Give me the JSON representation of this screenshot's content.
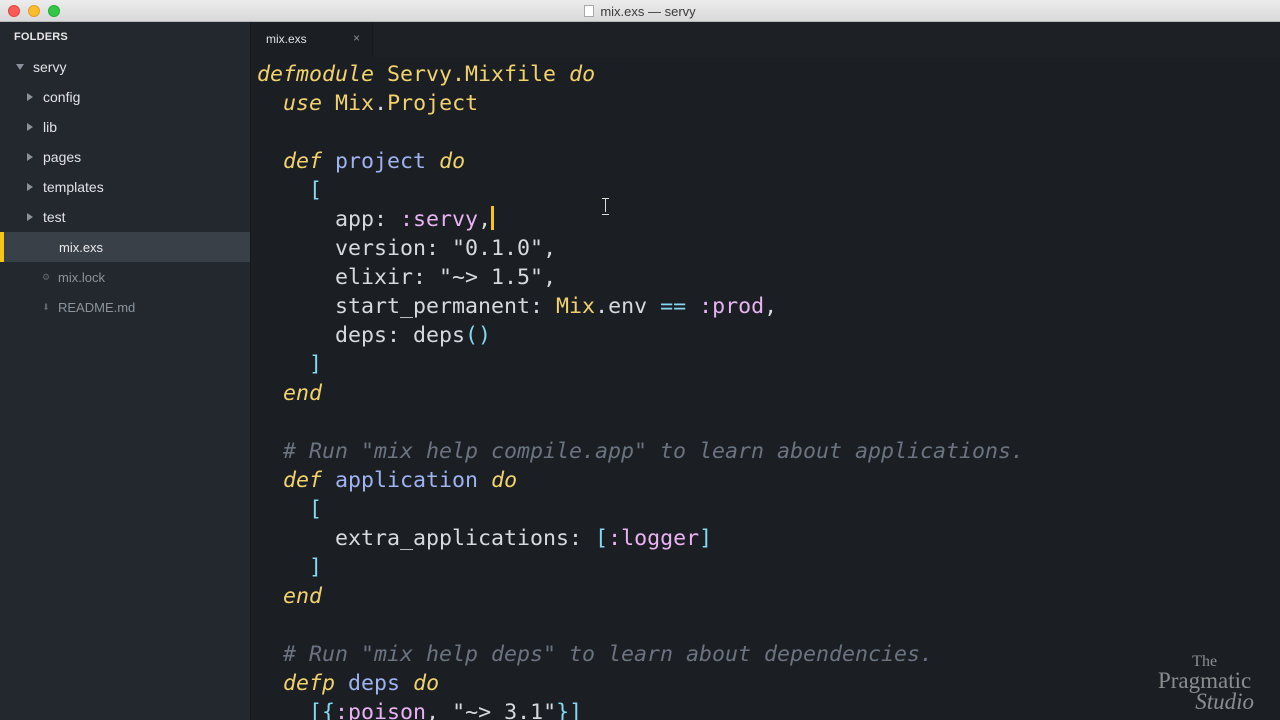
{
  "window": {
    "title": "mix.exs — servy"
  },
  "sidebar": {
    "header": "FOLDERS",
    "root": "servy",
    "folders": [
      "config",
      "lib",
      "pages",
      "templates",
      "test"
    ],
    "files": [
      {
        "name": "mix.exs",
        "selected": true
      },
      {
        "name": "mix.lock",
        "selected": false
      },
      {
        "name": "README.md",
        "selected": false
      }
    ]
  },
  "tabs": [
    {
      "label": "mix.exs",
      "close": "×"
    }
  ],
  "code": {
    "lines": [
      [
        {
          "t": "defmodule",
          "c": "kw"
        },
        {
          "t": " "
        },
        {
          "t": "Servy.Mixfile",
          "c": "mod"
        },
        {
          "t": " "
        },
        {
          "t": "do",
          "c": "kw"
        }
      ],
      [
        {
          "t": "  "
        },
        {
          "t": "use",
          "c": "kw"
        },
        {
          "t": " "
        },
        {
          "t": "Mix",
          "c": "mod"
        },
        {
          "t": "."
        },
        {
          "t": "Project",
          "c": "mod"
        }
      ],
      [],
      [
        {
          "t": "  "
        },
        {
          "t": "def",
          "c": "kw"
        },
        {
          "t": " "
        },
        {
          "t": "project",
          "c": "fn"
        },
        {
          "t": " "
        },
        {
          "t": "do",
          "c": "kw"
        }
      ],
      [
        {
          "t": "    "
        },
        {
          "t": "[",
          "c": "brk"
        }
      ],
      [
        {
          "t": "      "
        },
        {
          "t": "app:"
        },
        {
          "t": " "
        },
        {
          "t": ":servy",
          "c": "atom"
        },
        {
          "t": ","
        },
        {
          "cursor": true
        }
      ],
      [
        {
          "t": "      "
        },
        {
          "t": "version:"
        },
        {
          "t": " "
        },
        {
          "t": "\"0.1.0\"",
          "c": "str"
        },
        {
          "t": ","
        }
      ],
      [
        {
          "t": "      "
        },
        {
          "t": "elixir:"
        },
        {
          "t": " "
        },
        {
          "t": "\"~> 1.5\"",
          "c": "str"
        },
        {
          "t": ","
        }
      ],
      [
        {
          "t": "      "
        },
        {
          "t": "start_permanent:"
        },
        {
          "t": " "
        },
        {
          "t": "Mix",
          "c": "mod"
        },
        {
          "t": ".env "
        },
        {
          "t": "==",
          "c": "op"
        },
        {
          "t": " "
        },
        {
          "t": ":prod",
          "c": "atom"
        },
        {
          "t": ","
        }
      ],
      [
        {
          "t": "      "
        },
        {
          "t": "deps:"
        },
        {
          "t": " deps"
        },
        {
          "t": "()",
          "c": "brk"
        }
      ],
      [
        {
          "t": "    "
        },
        {
          "t": "]",
          "c": "brk"
        }
      ],
      [
        {
          "t": "  "
        },
        {
          "t": "end",
          "c": "kw"
        }
      ],
      [],
      [
        {
          "t": "  "
        },
        {
          "t": "# Run \"mix help compile.app\" to learn about applications.",
          "c": "cmt"
        }
      ],
      [
        {
          "t": "  "
        },
        {
          "t": "def",
          "c": "kw"
        },
        {
          "t": " "
        },
        {
          "t": "application",
          "c": "fn"
        },
        {
          "t": " "
        },
        {
          "t": "do",
          "c": "kw"
        }
      ],
      [
        {
          "t": "    "
        },
        {
          "t": "[",
          "c": "brk"
        }
      ],
      [
        {
          "t": "      "
        },
        {
          "t": "extra_applications:"
        },
        {
          "t": " "
        },
        {
          "t": "[",
          "c": "brk"
        },
        {
          "t": ":logger",
          "c": "atom"
        },
        {
          "t": "]",
          "c": "brk"
        }
      ],
      [
        {
          "t": "    "
        },
        {
          "t": "]",
          "c": "brk"
        }
      ],
      [
        {
          "t": "  "
        },
        {
          "t": "end",
          "c": "kw"
        }
      ],
      [],
      [
        {
          "t": "  "
        },
        {
          "t": "# Run \"mix help deps\" to learn about dependencies.",
          "c": "cmt"
        }
      ],
      [
        {
          "t": "  "
        },
        {
          "t": "defp",
          "c": "kw"
        },
        {
          "t": " "
        },
        {
          "t": "deps",
          "c": "fn"
        },
        {
          "t": " "
        },
        {
          "t": "do",
          "c": "kw"
        }
      ],
      [
        {
          "t": "    "
        },
        {
          "t": "[{",
          "c": "brk"
        },
        {
          "t": ":poison",
          "c": "atom"
        },
        {
          "t": ", "
        },
        {
          "t": "\"~> 3.1\"",
          "c": "str"
        },
        {
          "t": "}]",
          "c": "brk"
        }
      ]
    ]
  },
  "watermark": {
    "line1": "The",
    "line2": "Pragmatic",
    "line3": "Studio"
  }
}
